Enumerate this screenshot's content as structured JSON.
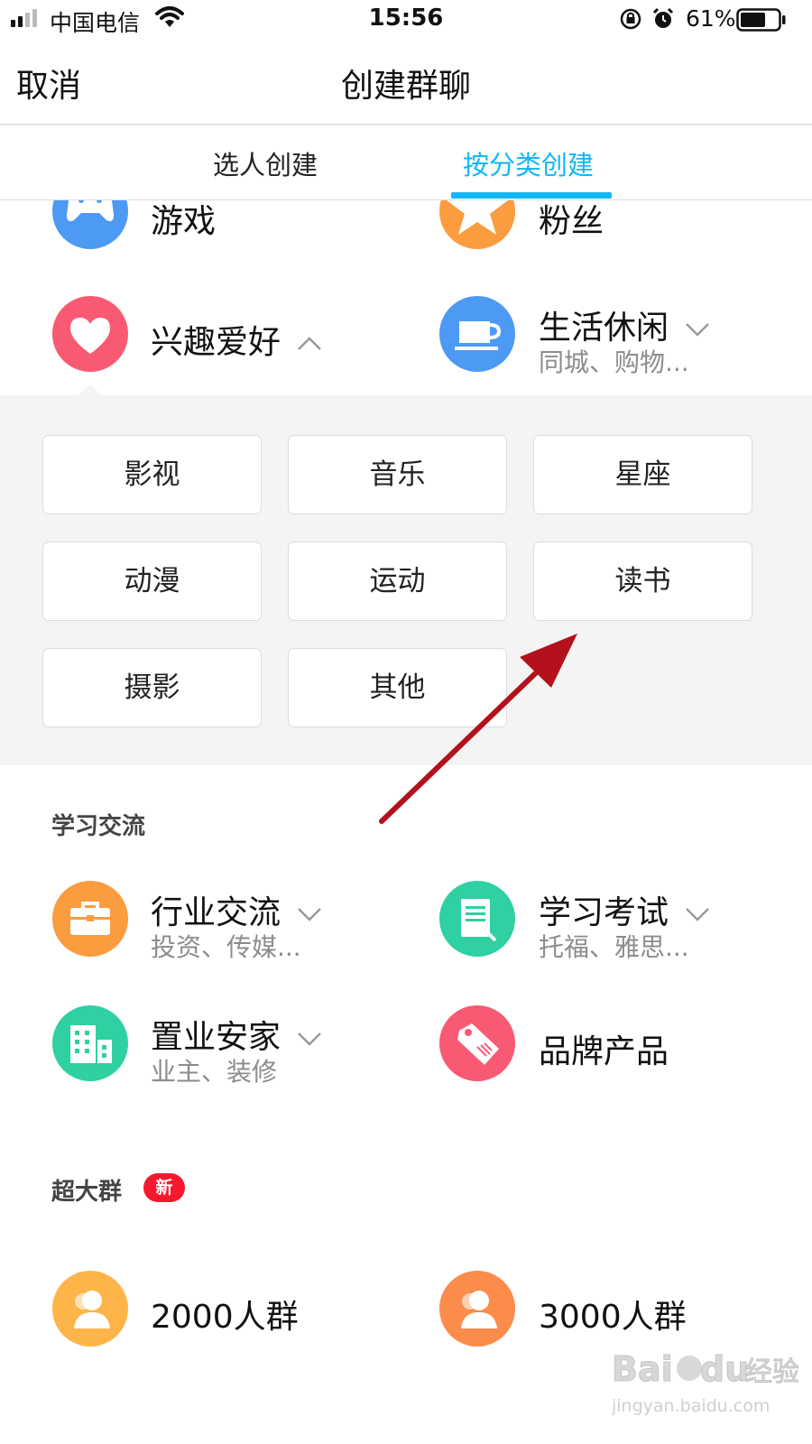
{
  "status_bar": {
    "carrier": "中国电信",
    "time": "15:56",
    "battery": "61%"
  },
  "nav": {
    "cancel": "取消",
    "title": "创建群聊"
  },
  "tabs": [
    {
      "label": "选人创建"
    },
    {
      "label": "按分类创建",
      "active": true
    }
  ],
  "categories_top": [
    {
      "title": "游戏",
      "icon": "gamepad-icon",
      "color": "#4d9af5"
    },
    {
      "title": "粉丝",
      "icon": "star-icon",
      "color": "#fb9c3f"
    },
    {
      "title": "兴趣爱好",
      "icon": "heart-icon",
      "color": "#f95a73",
      "expanded": true
    },
    {
      "title": "生活休闲",
      "subtitle": "同城、购物...",
      "icon": "cup-icon",
      "color": "#4d9af5"
    }
  ],
  "interest_subcategories": [
    "影视",
    "音乐",
    "星座",
    "动漫",
    "运动",
    "读书",
    "摄影",
    "其他"
  ],
  "study_section": {
    "title": "学习交流",
    "items": [
      {
        "title": "行业交流",
        "subtitle": "投资、传媒...",
        "icon": "briefcase-icon",
        "color": "#fb9c3f"
      },
      {
        "title": "学习考试",
        "subtitle": "托福、雅思...",
        "icon": "document-icon",
        "color": "#2fd0a1"
      },
      {
        "title": "置业安家",
        "subtitle": "业主、装修",
        "icon": "building-icon",
        "color": "#2fd0a1"
      },
      {
        "title": "品牌产品",
        "icon": "tag-icon",
        "color": "#f95a73"
      }
    ]
  },
  "big_group_section": {
    "title": "超大群",
    "badge": "新",
    "items": [
      {
        "title": "2000人群",
        "icon": "group-icon",
        "color": "#fdb54a"
      },
      {
        "title": "3000人群",
        "icon": "group-icon",
        "color": "#fb8c4a"
      }
    ]
  },
  "annotation": {
    "color": "#b3121c"
  },
  "watermark": {
    "brand": "Bai du 经验",
    "url": "jingyan.baidu.com"
  }
}
